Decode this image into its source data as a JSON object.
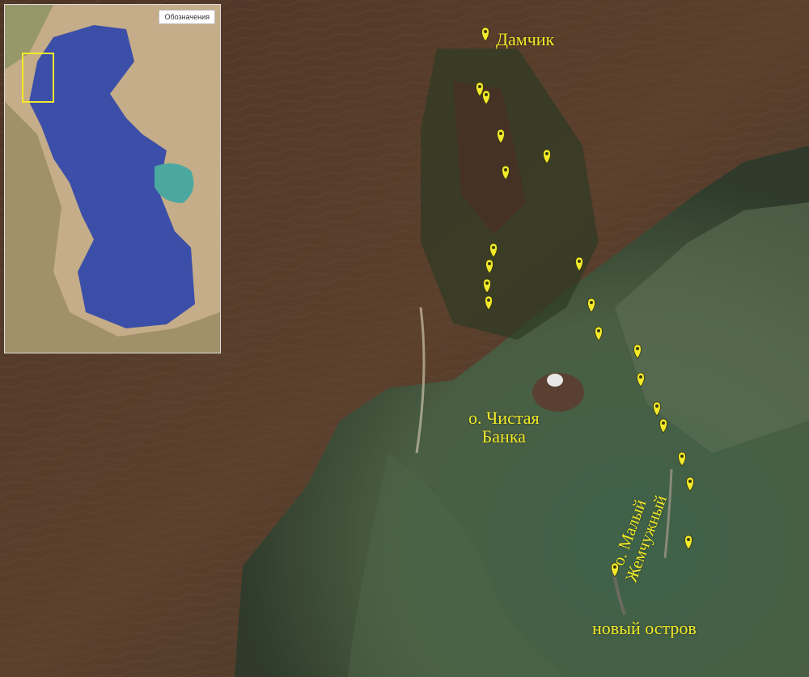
{
  "map": {
    "labels": {
      "damchik": "Дамчик",
      "chistaya_line1": "о. Чистая",
      "chistaya_line2": "Банка",
      "novy": "новый остров",
      "maly_line1": "о. Малый",
      "maly_line2": "Жемчужный"
    },
    "marker_color": "#f2ea2a",
    "colors": {
      "sea": "#3f5a43",
      "land": "#5a3f2c",
      "caspian": "#3c4fa8"
    }
  },
  "inset": {
    "legend_label": "Обозначения",
    "highlight_color": "#f2ea2a"
  }
}
